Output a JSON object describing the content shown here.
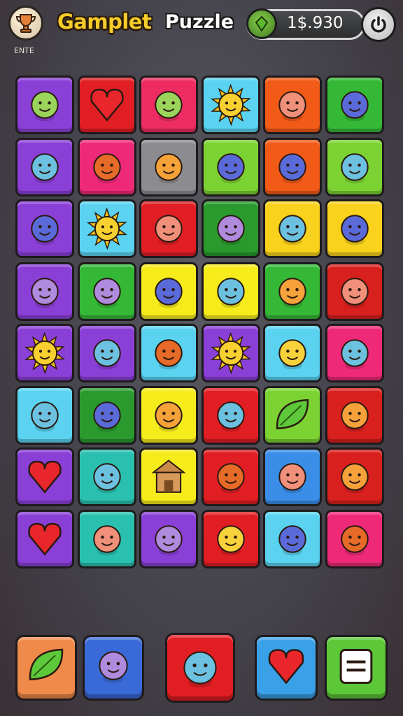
{
  "header": {
    "trophy_label": "ENTE",
    "title": "Gamplet",
    "subtitle": "Puzzle",
    "coin_value": "1$.930"
  },
  "board": {
    "rows": 8,
    "cols": 6,
    "tiles": [
      {
        "color": "#8a3fd6",
        "icon": "bird-and-bug-icon"
      },
      {
        "color": "#e01e24",
        "icon": "heart-and-face-icon"
      },
      {
        "color": "#ec2c62",
        "icon": "clock-and-ghost-icon"
      },
      {
        "color": "#5ad2f0",
        "icon": "sun-and-pie-icon"
      },
      {
        "color": "#f25a18",
        "icon": "cookie-and-crab-icon"
      },
      {
        "color": "#34b836",
        "icon": "bar-and-sun-icon"
      },
      {
        "color": "#8a3fd6",
        "icon": "crab-icon"
      },
      {
        "color": "#ee2a78",
        "icon": "radio-icon"
      },
      {
        "color": "#8c8c90",
        "icon": "cat-icon"
      },
      {
        "color": "#7cd232",
        "icon": "penguin-icon"
      },
      {
        "color": "#f25a18",
        "icon": "cat-face-icon"
      },
      {
        "color": "#7cd232",
        "icon": "cart-icon"
      },
      {
        "color": "#8a3fd6",
        "icon": "car-icon"
      },
      {
        "color": "#5ad2f0",
        "icon": "sun-icon"
      },
      {
        "color": "#e01e24",
        "icon": "octopus-icon"
      },
      {
        "color": "#2a9a2e",
        "icon": "snail-icon"
      },
      {
        "color": "#f8d21c",
        "icon": "pilot-icon"
      },
      {
        "color": "#f8d21c",
        "icon": "owl-icon"
      },
      {
        "color": "#8a3fd6",
        "icon": "smile-and-plane-icon"
      },
      {
        "color": "#34b836",
        "icon": "tomato-and-whistle-icon"
      },
      {
        "color": "#f6ec1c",
        "icon": "smile-and-bike-icon"
      },
      {
        "color": "#f6ec1c",
        "icon": "lion-and-cherry-icon"
      },
      {
        "color": "#34b836",
        "icon": "smile-and-snail-icon"
      },
      {
        "color": "#d8201e",
        "icon": "fox-icon"
      },
      {
        "color": "#8a3fd6",
        "icon": "sun-icon"
      },
      {
        "color": "#8a3fd6",
        "icon": "fish-icon"
      },
      {
        "color": "#5ad2f0",
        "icon": "box-icon"
      },
      {
        "color": "#8a3fd6",
        "icon": "sun-icon"
      },
      {
        "color": "#5ad2f0",
        "icon": "face-icon"
      },
      {
        "color": "#ee2a78",
        "icon": "blue-blob-icon"
      },
      {
        "color": "#5ad2f0",
        "icon": "smile-icon"
      },
      {
        "color": "#2a9a2e",
        "icon": "bear-icon"
      },
      {
        "color": "#f6ec1c",
        "icon": "cat-icon"
      },
      {
        "color": "#e01e24",
        "icon": "gem-heart-icon"
      },
      {
        "color": "#7cd232",
        "icon": "leaf-icon"
      },
      {
        "color": "#d8201e",
        "icon": "deer-icon"
      },
      {
        "color": "#8a3fd6",
        "icon": "heart-icon"
      },
      {
        "color": "#2ac0b0",
        "icon": "ice-cream-icon"
      },
      {
        "color": "#f6ec1c",
        "icon": "house-icon"
      },
      {
        "color": "#e01e24",
        "icon": "monkey-icon"
      },
      {
        "color": "#3a8ee8",
        "icon": "ghost-icon"
      },
      {
        "color": "#d8201e",
        "icon": "teal-gem-icon"
      },
      {
        "color": "#8a3fd6",
        "icon": "heart-icon"
      },
      {
        "color": "#2ac0b0",
        "icon": "balloon-icon"
      },
      {
        "color": "#8a3fd6",
        "icon": "bird-icon"
      },
      {
        "color": "#e01e24",
        "icon": "green-alien-icon"
      },
      {
        "color": "#5ad2f0",
        "icon": "lion-icon"
      },
      {
        "color": "#ee2a78",
        "icon": "blue-cat-icon"
      }
    ]
  },
  "bottom_buttons": [
    {
      "color": "#f08a4a",
      "icon": "leaf-icon"
    },
    {
      "color": "#3a6ad8",
      "icon": "chat-heart-icon"
    },
    {
      "color": "#e01e24",
      "icon": "green-splat-icon"
    },
    {
      "color": "#3aa0e8",
      "icon": "heart-leaf-icon"
    },
    {
      "color": "#5cc838",
      "icon": "menu-icon"
    }
  ]
}
